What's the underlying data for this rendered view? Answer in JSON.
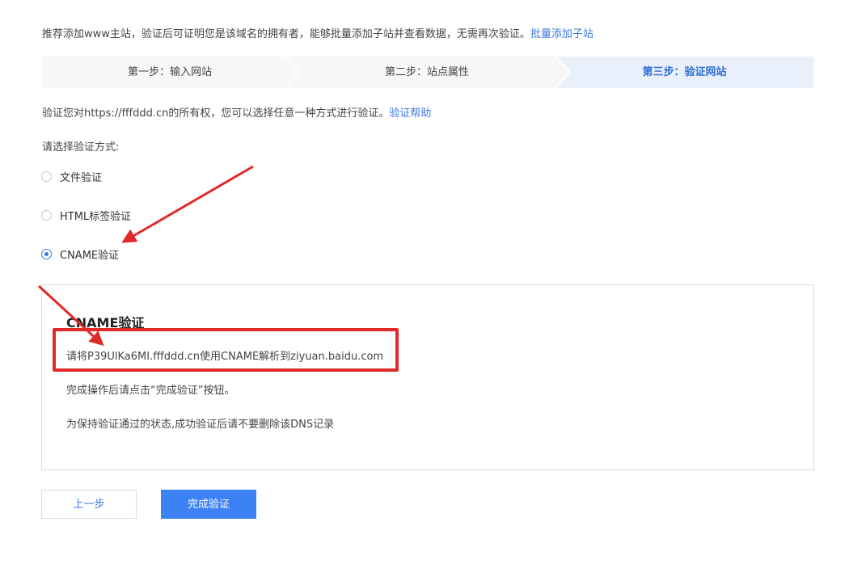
{
  "intro": {
    "text": "推荐添加www主站，验证后可证明您是该域名的拥有者，能够批量添加子站并查看数据，无需再次验证。",
    "link": "批量添加子站"
  },
  "steps": [
    {
      "label": "第一步：输入网站"
    },
    {
      "label": "第二步：站点属性"
    },
    {
      "label": "第三步：验证网站"
    }
  ],
  "verify": {
    "text": "验证您对https://fffddd.cn的所有权，您可以选择任意一种方式进行验证。",
    "help_link": "验证帮助",
    "choose_label": "请选择验证方式:"
  },
  "methods": [
    {
      "label": "文件验证",
      "selected": false
    },
    {
      "label": "HTML标签验证",
      "selected": false
    },
    {
      "label": "CNAME验证",
      "selected": true
    }
  ],
  "panel": {
    "title": "CNAME验证",
    "instruction": "请将P39UlKa6MI.fffddd.cn使用CNAME解析到ziyuan.baidu.com",
    "after_action": "完成操作后请点击“完成验证”按钮。",
    "keep_note": "为保持验证通过的状态,成功验证后请不要删除该DNS记录"
  },
  "buttons": {
    "prev": "上一步",
    "done": "完成验证"
  },
  "colors": {
    "accent": "#3a78e0",
    "primary_button": "#3d82f5",
    "annotation_red": "#e02a2a",
    "active_step_bg": "#e9f0fb"
  }
}
